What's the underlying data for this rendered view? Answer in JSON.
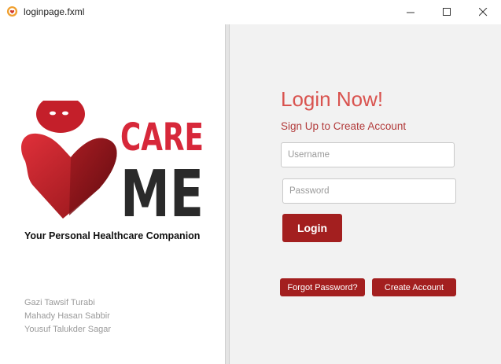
{
  "window": {
    "title": "loginpage.fxml",
    "app_icon": "app-icon"
  },
  "left": {
    "brand_word_1": "CARE",
    "brand_word_2": "ME",
    "tagline": "Your Personal Healthcare Companion",
    "credits": [
      "Gazi Tawsif Turabi",
      "Mahady Hasan Sabbir",
      "Yousuf Talukder Sagar"
    ]
  },
  "login": {
    "title": "Login Now!",
    "subtitle": "Sign Up to Create Account",
    "username_placeholder": "Username",
    "password_placeholder": "Password",
    "login_label": "Login",
    "forgot_label": "Forgot Password?",
    "create_label": "Create Account"
  },
  "colors": {
    "accent": "#a31f1f",
    "title_red": "#d9534f",
    "panel_bg": "#f2f2f2"
  }
}
